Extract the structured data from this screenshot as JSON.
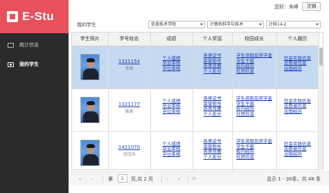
{
  "app": {
    "name": "E-Stu",
    "greeting": "您好：朱峰",
    "logout_label": "注销"
  },
  "sidebar": {
    "items": [
      {
        "label": "统计信息",
        "icon": "monitor-icon",
        "active": false
      },
      {
        "label": "我的学生",
        "icon": "students-icon",
        "active": true
      }
    ]
  },
  "filters": {
    "breadcrumb": "我的学生",
    "college": "信息技术学院",
    "major": "计算机科学与技术",
    "class": "计科14-2"
  },
  "table": {
    "columns": [
      "学生照片",
      "学号姓名",
      "成绩",
      "个人奖惩",
      "校园成长",
      "个人履历"
    ],
    "link_sets": {
      "grades": [
        "个人成绩",
        "毕业审核",
        "学位审核"
      ],
      "awards": [
        "各类证书",
        "荣誉称号",
        "各类竞赛",
        "个人处分"
      ],
      "growth": [
        "学生资助及奖学金",
        "学生干部",
        "校内经历",
        "社团信息"
      ],
      "resume": [
        "社会实践信息",
        "志愿者信息",
        "出国经历"
      ]
    },
    "rows": [
      {
        "id": "1321154",
        "name": "李峰",
        "selected": true
      },
      {
        "id": "1321177",
        "name": "黄颖",
        "selected": false
      },
      {
        "id": "1421070",
        "name": "刘佳伟",
        "selected": false
      }
    ]
  },
  "pager": {
    "page_label": "第",
    "current_page": "1",
    "total_text": "页,共 2 页",
    "range_text": "显示 1 - 30条，共 48 条"
  }
}
